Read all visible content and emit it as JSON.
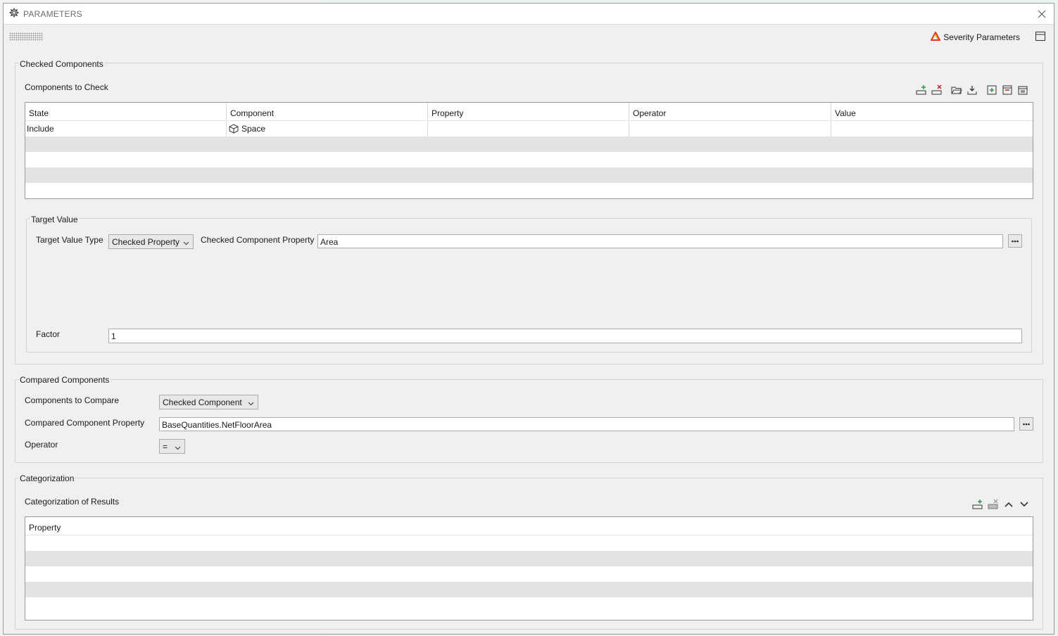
{
  "window": {
    "title": "PARAMETERS"
  },
  "toolstrip": {
    "severity_label": "Severity Parameters"
  },
  "checked_components": {
    "group_label": "Checked Components",
    "section_label": "Components to Check",
    "columns": [
      "State",
      "Component",
      "Property",
      "Operator",
      "Value"
    ],
    "rows": [
      {
        "state": "Include",
        "component": "Space",
        "property": "",
        "operator": "",
        "value": ""
      }
    ],
    "target_value": {
      "group_label": "Target Value",
      "type_label": "Target Value Type",
      "type_value": "Checked Property",
      "property_label": "Checked Component Property",
      "property_value": "Area",
      "factor_label": "Factor",
      "factor_value": "1"
    }
  },
  "compared_components": {
    "group_label": "Compared Components",
    "compare_label": "Components to Compare",
    "compare_value": "Checked Component",
    "property_label": "Compared Component Property",
    "property_value": "BaseQuantities.NetFloorArea",
    "operator_label": "Operator",
    "operator_value": "="
  },
  "categorization": {
    "group_label": "Categorization",
    "section_label": "Categorization of Results",
    "columns": [
      "Property"
    ]
  },
  "colors": {
    "severity_icon_red": "#e03a1e",
    "severity_icon_orange": "#f0a000",
    "add_green": "#2a9d3a",
    "delete_red": "#d02020"
  }
}
